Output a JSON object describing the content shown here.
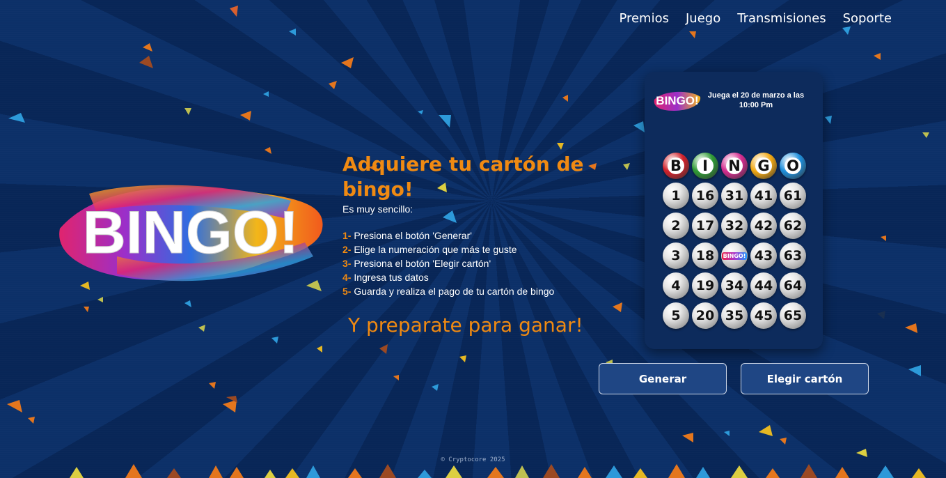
{
  "nav": {
    "items": [
      "Premios",
      "Juego",
      "Transmisiones",
      "Soporte"
    ]
  },
  "logo": {
    "text": "BINGO!"
  },
  "content": {
    "title": "Adquiere tu cartón de bingo!",
    "lead": "Es muy sencillo:",
    "steps": [
      {
        "num": "1-",
        "text": "Presiona el botón 'Generar'"
      },
      {
        "num": "2-",
        "text": "Elige la numeración que más te guste"
      },
      {
        "num": "3-",
        "text": "Presiona el botón 'Elegir cartón'"
      },
      {
        "num": "4-",
        "text": "Ingresa tus datos"
      },
      {
        "num": "5-",
        "text": "Guarda y realiza el pago de tu cartón de bingo"
      }
    ],
    "closing": "Y preparate para ganar!"
  },
  "card": {
    "logo_text": "BINGO!",
    "date_text": "Juega el 20 de marzo a las 10:00 Pm",
    "headers": [
      {
        "letter": "B",
        "color": "#d2212b"
      },
      {
        "letter": "I",
        "color": "#2f9b35"
      },
      {
        "letter": "N",
        "color": "#d42b8f"
      },
      {
        "letter": "G",
        "color": "#f2a812"
      },
      {
        "letter": "O",
        "color": "#1e8fdc"
      }
    ],
    "rows": [
      [
        "1",
        "16",
        "31",
        "41",
        "61"
      ],
      [
        "2",
        "17",
        "32",
        "42",
        "62"
      ],
      [
        "3",
        "18",
        "FREE",
        "43",
        "63"
      ],
      [
        "4",
        "19",
        "34",
        "44",
        "64"
      ],
      [
        "5",
        "20",
        "35",
        "45",
        "65"
      ]
    ],
    "free_label": "BINGO!"
  },
  "buttons": {
    "generate": "Generar",
    "choose": "Elegir cartón"
  },
  "footer": "© Cryptocore 2025",
  "colors": {
    "accent": "#f08a12",
    "background": "#0b2c63",
    "button": "#1f4684"
  }
}
